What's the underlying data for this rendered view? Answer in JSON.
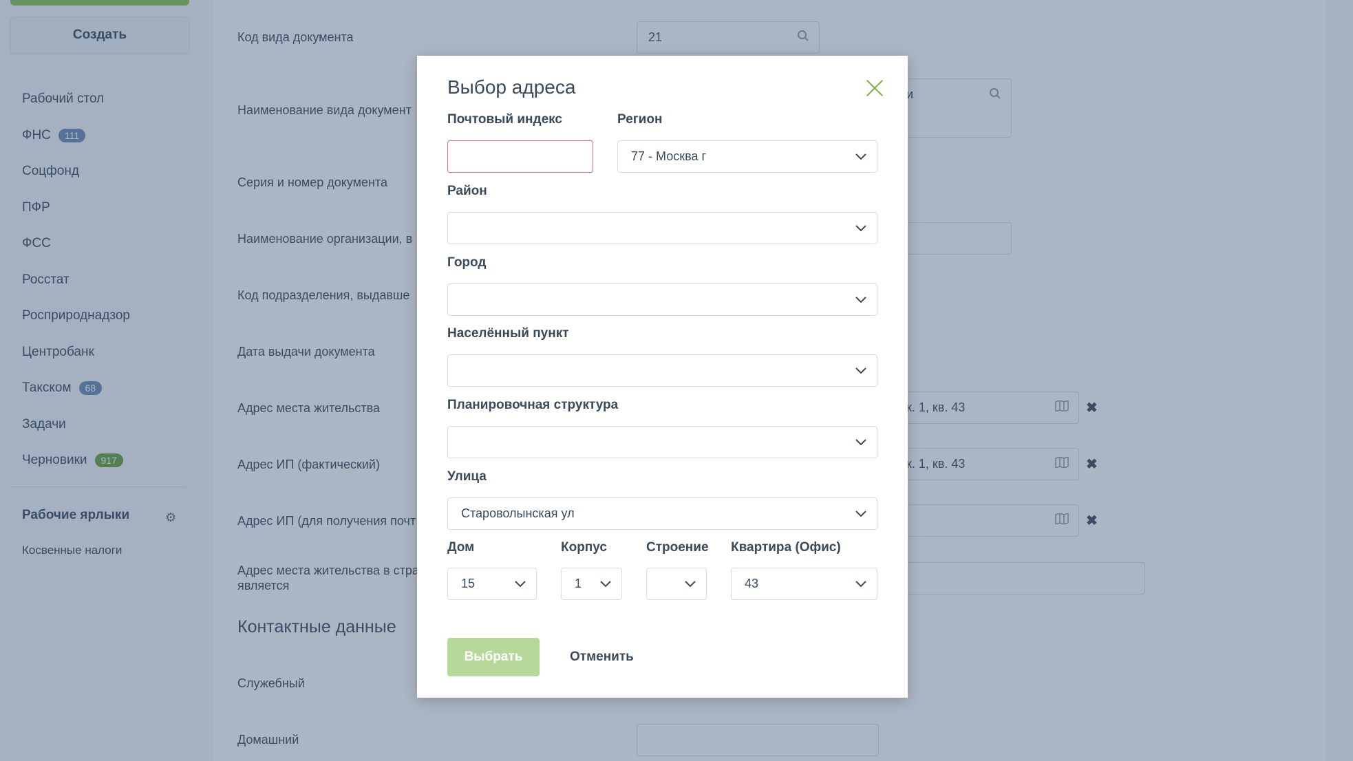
{
  "sidebar": {
    "create_label": "Создать",
    "items": [
      {
        "label": "Рабочий стол",
        "badge": ""
      },
      {
        "label": "ФНС",
        "badge": "111"
      },
      {
        "label": "Соцфонд",
        "badge": ""
      },
      {
        "label": "ПФР",
        "badge": ""
      },
      {
        "label": "ФСС",
        "badge": ""
      },
      {
        "label": "Росстат",
        "badge": ""
      },
      {
        "label": "Росприроднадзор",
        "badge": ""
      },
      {
        "label": "Центробанк",
        "badge": ""
      },
      {
        "label": "Такском",
        "badge": "68"
      },
      {
        "label": "Задачи",
        "badge": ""
      },
      {
        "label": "Черновики",
        "badge": "917"
      }
    ],
    "shortcuts_title": "Рабочие ярлыки",
    "shortcut_item": "Косвенные налоги"
  },
  "form": {
    "doc_code_label": "Код вида документа",
    "doc_code_value": "21",
    "doc_name_label": "Наименование вида документ",
    "doc_name_value_tail": "и",
    "series_label": "Серия и номер документа",
    "org_label": "Наименование организации, в",
    "dept_code_label": "Код подразделения, выдавше",
    "issue_date_label": "Дата выдачи документа",
    "residence_label": "Адрес места жительства",
    "residence_value_tail": "к. 1, кв. 43",
    "ip_actual_label": "Адрес ИП (фактический)",
    "ip_actual_value_tail": "к. 1, кв. 43",
    "ip_mail_label": "Адрес ИП (для получения почт",
    "country_label_line1": "Адрес места жительства в стра",
    "country_label_line2": "является",
    "contacts_title": "Контактные данные",
    "work_label": "Служебный",
    "home_label": "Домашний"
  },
  "modal": {
    "title": "Выбор адреса",
    "postal_label": "Почтовый индекс",
    "postal_value": "",
    "region_label": "Регион",
    "region_value": "77 - Москва г",
    "district_label": "Район",
    "district_value": "",
    "city_label": "Город",
    "city_value": "",
    "locality_label": "Населённый пункт",
    "locality_value": "",
    "planning_label": "Планировочная структура",
    "planning_value": "",
    "street_label": "Улица",
    "street_value": "Староволынская ул",
    "house_label": "Дом",
    "house_value": "15",
    "building_label": "Корпус",
    "building_value": "1",
    "structure_label": "Строение",
    "structure_value": "",
    "apartment_label": "Квартира (Офис)",
    "apartment_value": "43",
    "select_label": "Выбрать",
    "cancel_label": "Отменить"
  }
}
